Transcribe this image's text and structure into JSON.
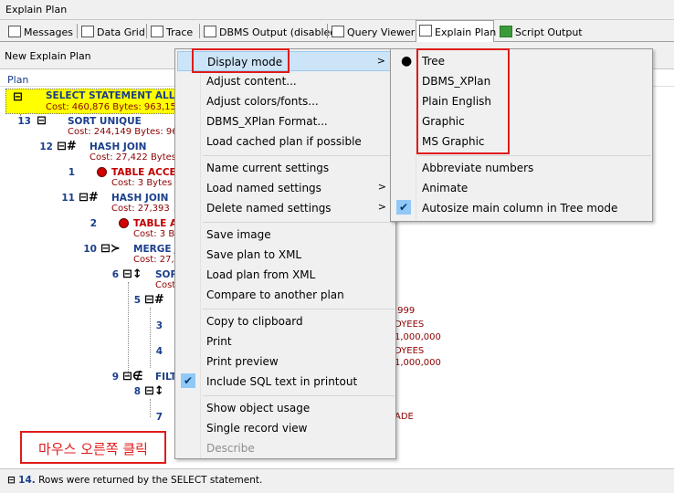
{
  "window": {
    "title": "Explain Plan"
  },
  "tabs": [
    {
      "label": "Messages",
      "icon": "messages-icon"
    },
    {
      "label": "Data Grid",
      "icon": "grid-icon"
    },
    {
      "label": "Trace",
      "icon": "trace-icon"
    },
    {
      "label": "DBMS Output (disabled)",
      "icon": "dbms-output-icon"
    },
    {
      "label": "Query Viewer",
      "icon": "query-viewer-icon"
    },
    {
      "label": "Explain Plan",
      "icon": "explain-plan-icon"
    },
    {
      "label": "Script Output",
      "icon": "script-output-icon"
    }
  ],
  "subbar": {
    "label": "New Explain Plan"
  },
  "plan": {
    "header": "Plan",
    "rows": [
      {
        "num": "",
        "op": "SELECT STATEMENT  ALL_R",
        "cost": "Cost: 460,876  Bytes: 963,15"
      },
      {
        "num": "13",
        "op": "SORT UNIQUE",
        "cost": "Cost: 244,149  Bytes: 96"
      },
      {
        "num": "12",
        "op": "HASH JOIN",
        "cost": "Cost: 27,422  Bytes: 9"
      },
      {
        "num": "1",
        "op": "TABLE ACCES",
        "cost": "Cost: 3  Bytes"
      },
      {
        "num": "11",
        "op": "HASH JOIN",
        "cost": "Cost: 27,393"
      },
      {
        "num": "2",
        "op": "TABLE A",
        "cost": "Cost: 3  B"
      },
      {
        "num": "10",
        "op": "MERGE J",
        "cost": "Cost: 27,"
      },
      {
        "num": "6",
        "op": "SOR",
        "cost": "Cost"
      },
      {
        "num": "5",
        "op": "",
        "cost": ""
      },
      {
        "num": "3",
        "op": "",
        "cost": ""
      },
      {
        "num": "4",
        "op": "",
        "cost": ""
      },
      {
        "num": "9",
        "op": "FILT",
        "cost": ""
      },
      {
        "num": "8",
        "op": "",
        "cost": ""
      },
      {
        "num": "7",
        "op": "",
        "cost": ""
      }
    ],
    "right_texts": [
      ",999",
      "DYEES",
      "1,000,000",
      "DYEES",
      "1,000,000",
      "ADE"
    ]
  },
  "annotation": {
    "text": "마우스 오른쪽 클릭"
  },
  "status": {
    "num": "14.",
    "text": "Rows were returned by the SELECT statement."
  },
  "context_menu": {
    "items": [
      {
        "label": "Display mode",
        "submenu": true,
        "highlighted": true
      },
      {
        "label": "Adjust content..."
      },
      {
        "label": "Adjust colors/fonts..."
      },
      {
        "label": "DBMS_XPlan Format..."
      },
      {
        "label": "Load cached plan if possible"
      },
      {
        "label": "Name current settings"
      },
      {
        "label": "Load named settings",
        "submenu": true
      },
      {
        "label": "Delete named settings",
        "submenu": true
      },
      {
        "label": "Save image"
      },
      {
        "label": "Save plan to XML"
      },
      {
        "label": "Load plan from XML"
      },
      {
        "label": "Compare to another plan"
      },
      {
        "label": "Copy to clipboard"
      },
      {
        "label": "Print"
      },
      {
        "label": "Print preview"
      },
      {
        "label": "Include SQL text in printout",
        "checked": true
      },
      {
        "label": "Show object usage"
      },
      {
        "label": "Single record view"
      },
      {
        "label": "Describe",
        "disabled": true
      }
    ]
  },
  "submenu": {
    "items": [
      {
        "label": "Tree",
        "selected": true
      },
      {
        "label": "DBMS_XPlan"
      },
      {
        "label": "Plain English"
      },
      {
        "label": "Graphic"
      },
      {
        "label": "MS Graphic"
      },
      {
        "label": "Abbreviate numbers"
      },
      {
        "label": "Animate"
      },
      {
        "label": "Autosize main column in Tree mode",
        "checked": true
      }
    ]
  },
  "colors": {
    "highlight_box": "#e01b1b",
    "menu_highlight": "#cce4f7",
    "selected_row": "#ffff00"
  }
}
